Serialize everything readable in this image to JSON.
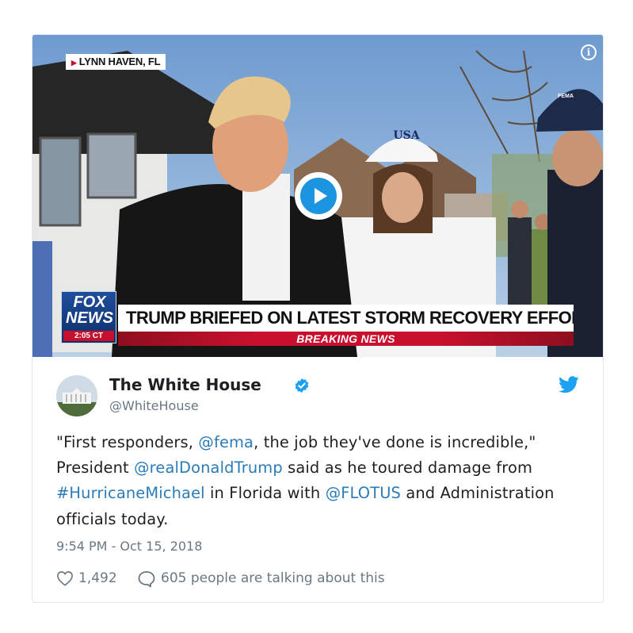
{
  "media": {
    "location_tag": "LYNN HAVEN, FL",
    "headline": "TRUMP BRIEFED ON LATEST STORM RECOVERY EFFORTS",
    "breaking": "BREAKING NEWS",
    "network_logo_top": "FOX",
    "network_logo_bottom": "NEWS",
    "network_time": "2:05 CT",
    "cap_text": "USA",
    "fema_cap_text": "FEMA",
    "info_icon": "info-icon",
    "play_icon": "play-icon"
  },
  "author": {
    "name": "The White House",
    "handle": "@WhiteHouse",
    "verified": true,
    "verified_color": "#1da1f2"
  },
  "tweet": {
    "segments": [
      {
        "text": "\"First responders, ",
        "link": false
      },
      {
        "text": "@fema",
        "link": true
      },
      {
        "text": ", the job they've done is incredible,\" President ",
        "link": false
      },
      {
        "text": "@realDonaldTrump",
        "link": true
      },
      {
        "text": " said as he toured damage from ",
        "link": false
      },
      {
        "text": "#HurricaneMichael",
        "link": true
      },
      {
        "text": " in Florida with ",
        "link": false
      },
      {
        "text": "@FLOTUS",
        "link": true
      },
      {
        "text": " and Administration officials today.",
        "link": false
      }
    ],
    "timestamp": "9:54 PM - Oct 15, 2018"
  },
  "actions": {
    "likes": "1,492",
    "talking": "605 people are talking about this",
    "like_icon": "heart-icon",
    "reply_icon": "speech-bubble-icon"
  },
  "colors": {
    "link": "#2b7bb9",
    "muted": "#697882",
    "accent": "#1b95e0",
    "news_red": "#c8102e",
    "news_blue": "#0e2f6b"
  }
}
